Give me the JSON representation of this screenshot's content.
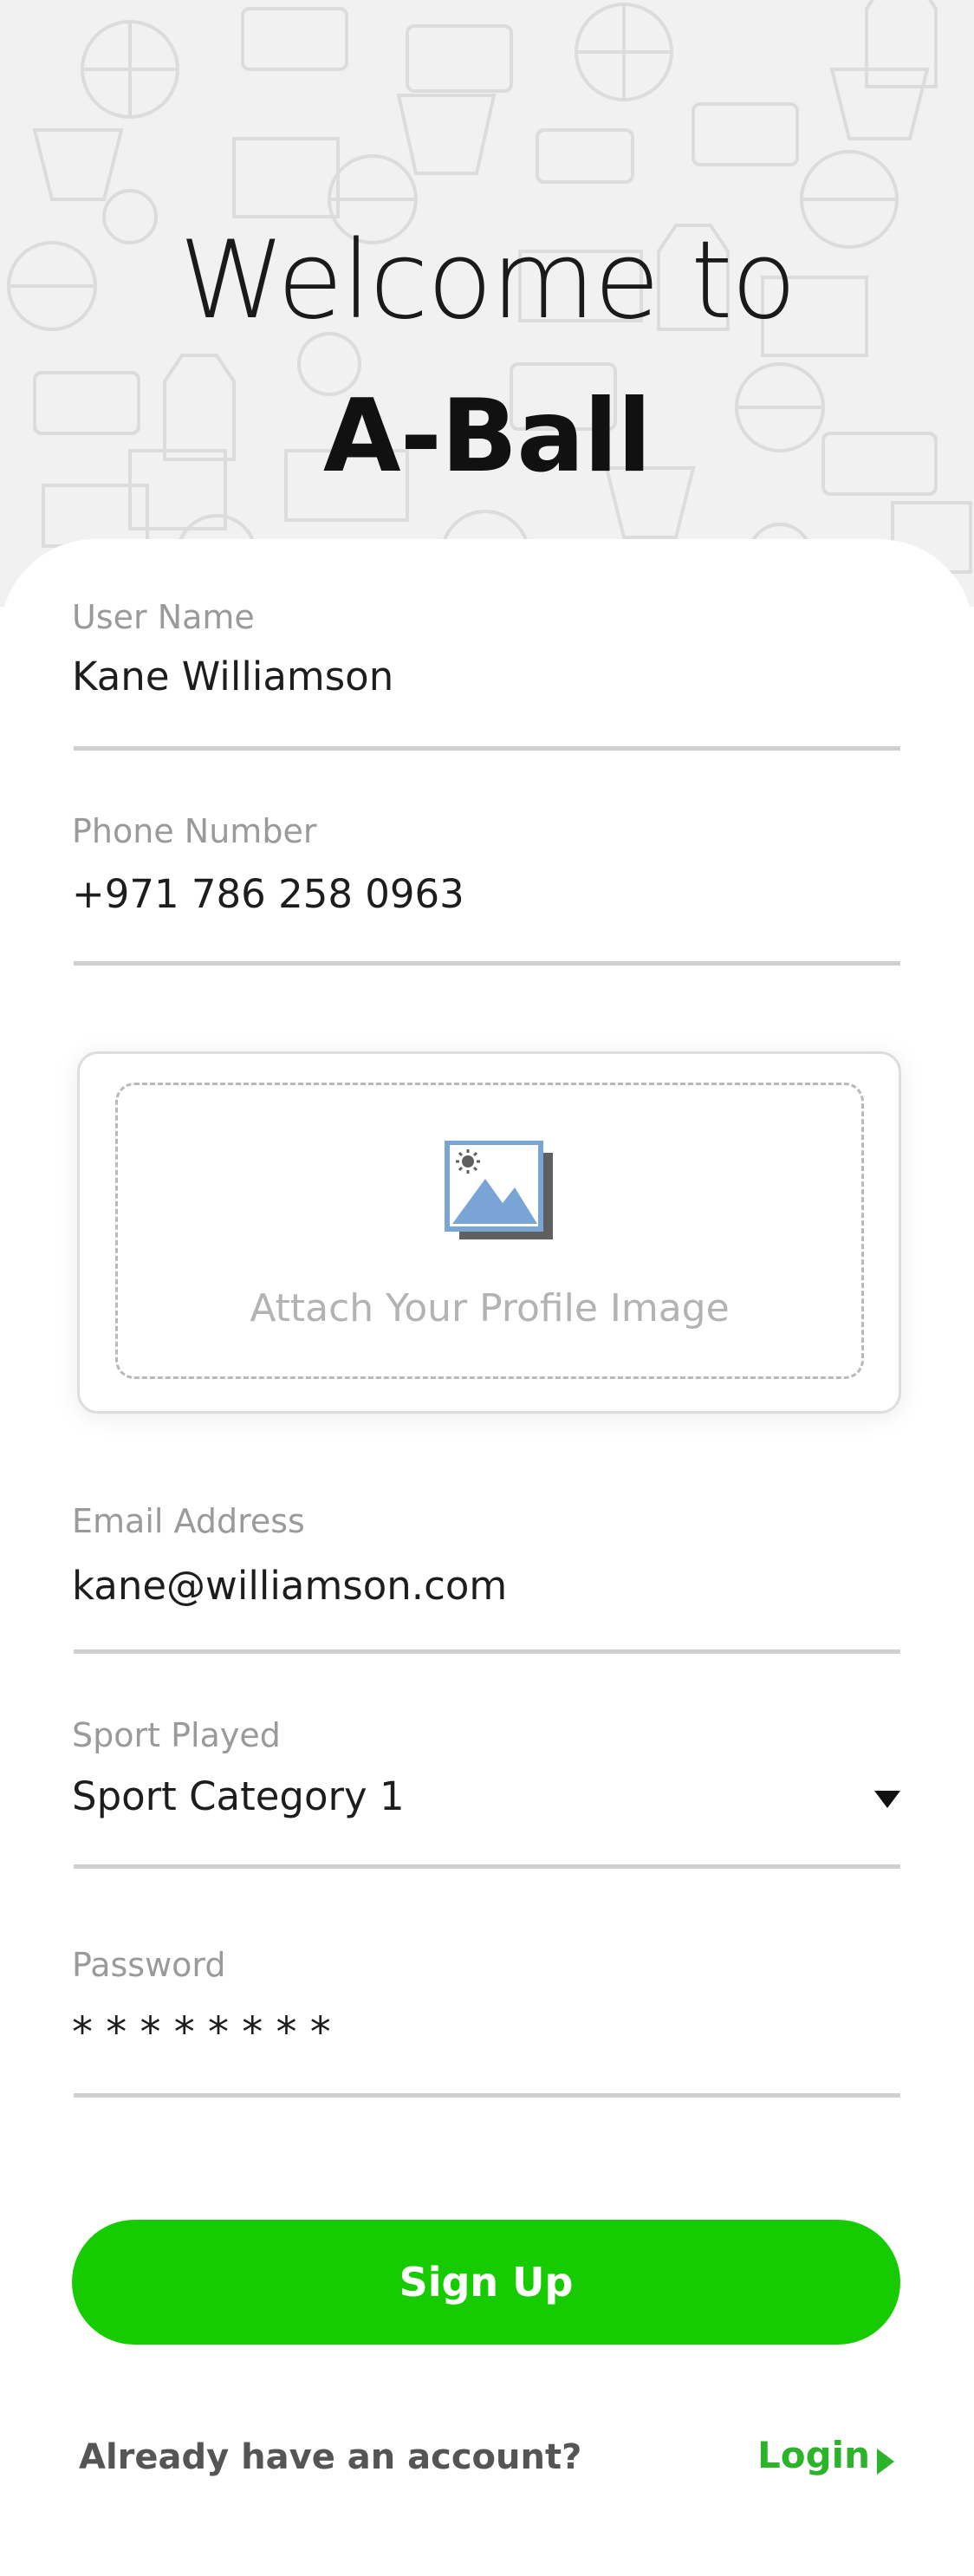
{
  "header": {
    "title_line1": "Welcome to",
    "title_line2": "A-Ball",
    "background_pattern": "basketball-icons-pattern"
  },
  "form": {
    "username": {
      "label": "User Name",
      "value": "Kane Williamson"
    },
    "phone": {
      "label": "Phone Number",
      "value": "+971 786 258 0963"
    },
    "profile_image": {
      "label": "Attach Your Profile Image",
      "icon": "image-icon"
    },
    "email": {
      "label": "Email Address",
      "value": "kane@williamson.com"
    },
    "sport": {
      "label": "Sport Played",
      "value": "Sport Category 1"
    },
    "password": {
      "label": "Password",
      "value": "* * * * * * * *"
    }
  },
  "actions": {
    "signup_label": "Sign Up",
    "footer_text": "Already have an account?",
    "login_label": "Login"
  },
  "colors": {
    "accent_green": "#16cc00",
    "link_green": "#2bb32a",
    "image_icon_blue": "#7ba4d6"
  }
}
